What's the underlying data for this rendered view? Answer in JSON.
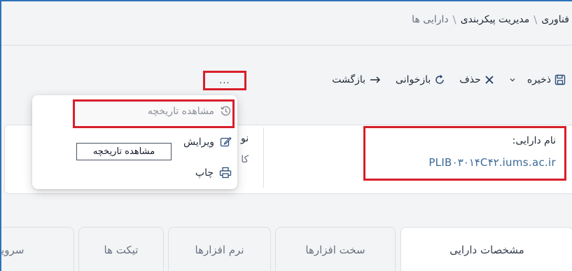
{
  "breadcrumb": {
    "items": [
      "فناوری",
      "مدیریت پیکربندی",
      "دارایی ها"
    ],
    "separator": "\\"
  },
  "toolbar": {
    "save_label": "ذخیره",
    "delete_label": "حذف",
    "reload_label": "بازخوانی",
    "back_label": "بازگشت",
    "more_label": "..."
  },
  "card": {
    "asset_name_label": "نام دارایی:",
    "asset_name_value": "PLIB۰۳۰۱۴C۴۲.iums.ac.ir",
    "col2_line1": "نو",
    "col2_line2": "کا"
  },
  "menu": {
    "items": [
      {
        "label": "مشاهده تاریخچه",
        "icon": "history-icon"
      },
      {
        "label": "ویرایش",
        "icon": "edit-icon"
      },
      {
        "label": "چاپ",
        "icon": "print-icon"
      }
    ],
    "tooltip": "مشاهده تاریخچه"
  },
  "tabs": [
    {
      "label": "مشخصات دارایی",
      "active": true
    },
    {
      "label": "سخت افزارها",
      "active": false
    },
    {
      "label": "نرم افزارها",
      "active": false
    },
    {
      "label": "تیکت ها",
      "active": false
    },
    {
      "label": "سرویس",
      "active": false
    }
  ],
  "colors": {
    "highlight": "#d81f2a",
    "frame": "#2d72b8",
    "value_text": "#3b6a96"
  }
}
